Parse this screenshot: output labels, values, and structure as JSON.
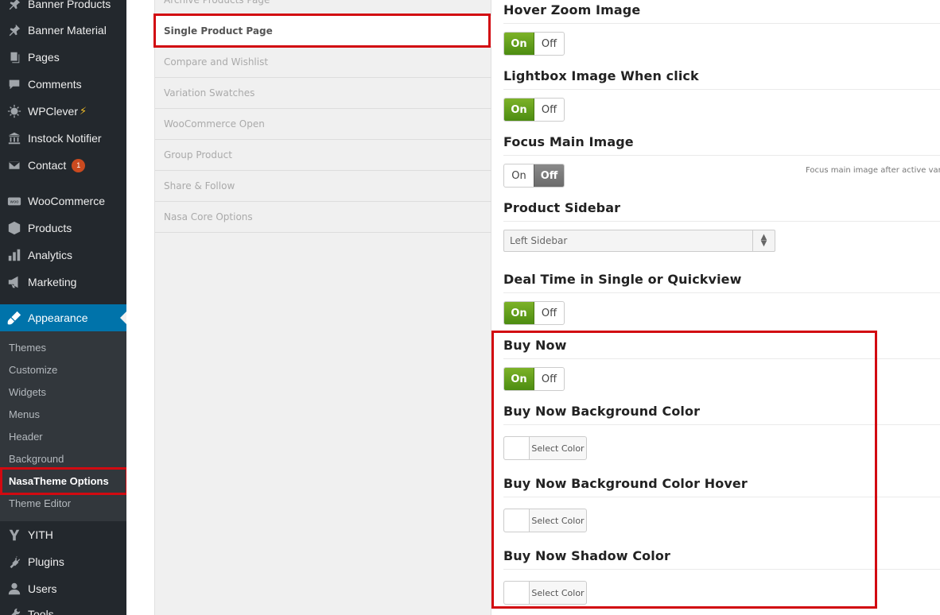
{
  "sidebar": {
    "items": [
      {
        "label": "Banner Products",
        "icon": "thumbtack-icon"
      },
      {
        "label": "Banner Material",
        "icon": "thumbtack-icon"
      },
      {
        "label": "Pages",
        "icon": "pages-icon"
      },
      {
        "label": "Comments",
        "icon": "comments-icon"
      },
      {
        "label": "WPClever",
        "icon": "wpclever-icon",
        "suffix": "⚡"
      },
      {
        "label": "Instock Notifier",
        "icon": "bank-icon"
      },
      {
        "label": "Contact",
        "icon": "email-icon",
        "badge": "1"
      },
      {
        "label": "WooCommerce",
        "icon": "woocommerce-icon"
      },
      {
        "label": "Products",
        "icon": "products-icon"
      },
      {
        "label": "Analytics",
        "icon": "analytics-icon"
      },
      {
        "label": "Marketing",
        "icon": "megaphone-icon"
      },
      {
        "label": "Appearance",
        "icon": "appearance-icon"
      },
      {
        "label": "YITH",
        "icon": "yith-icon"
      },
      {
        "label": "Plugins",
        "icon": "plugins-icon"
      },
      {
        "label": "Users",
        "icon": "users-icon"
      },
      {
        "label": "Tools",
        "icon": "tools-icon"
      }
    ],
    "submenu": [
      "Themes",
      "Customize",
      "Widgets",
      "Menus",
      "Header",
      "Background",
      "NasaTheme Options",
      "Theme Editor"
    ]
  },
  "options_nav": {
    "items": [
      "Archive Products Page",
      "Single Product Page",
      "Compare and Wishlist",
      "Variation Swatches",
      "WooCommerce Open",
      "Group Product",
      "Share & Follow",
      "Nasa Core Options"
    ]
  },
  "fields": {
    "hover_zoom": {
      "title": "Hover Zoom Image",
      "value": "On"
    },
    "lightbox": {
      "title": "Lightbox Image When click",
      "value": "On"
    },
    "focus_main": {
      "title": "Focus Main Image",
      "value": "Off",
      "description": "Focus main image after active varia"
    },
    "product_sidebar": {
      "title": "Product Sidebar",
      "value": "Left Sidebar"
    },
    "deal_time": {
      "title": "Deal Time in Single or Quickview",
      "value": "On"
    },
    "buy_now": {
      "title": "Buy Now",
      "value": "On"
    },
    "buy_now_bg": {
      "title": "Buy Now Background Color",
      "button": "Select Color"
    },
    "buy_now_bg_hover": {
      "title": "Buy Now Background Color Hover",
      "button": "Select Color"
    },
    "buy_now_shadow": {
      "title": "Buy Now Shadow Color",
      "button": "Select Color"
    }
  },
  "toggle_labels": {
    "on": "On",
    "off": "Off"
  },
  "colors": {
    "accent": "#0073aa",
    "admin_bg": "#23282d",
    "highlight": "#d20a11",
    "toggle_on": "#5f9e1a"
  }
}
